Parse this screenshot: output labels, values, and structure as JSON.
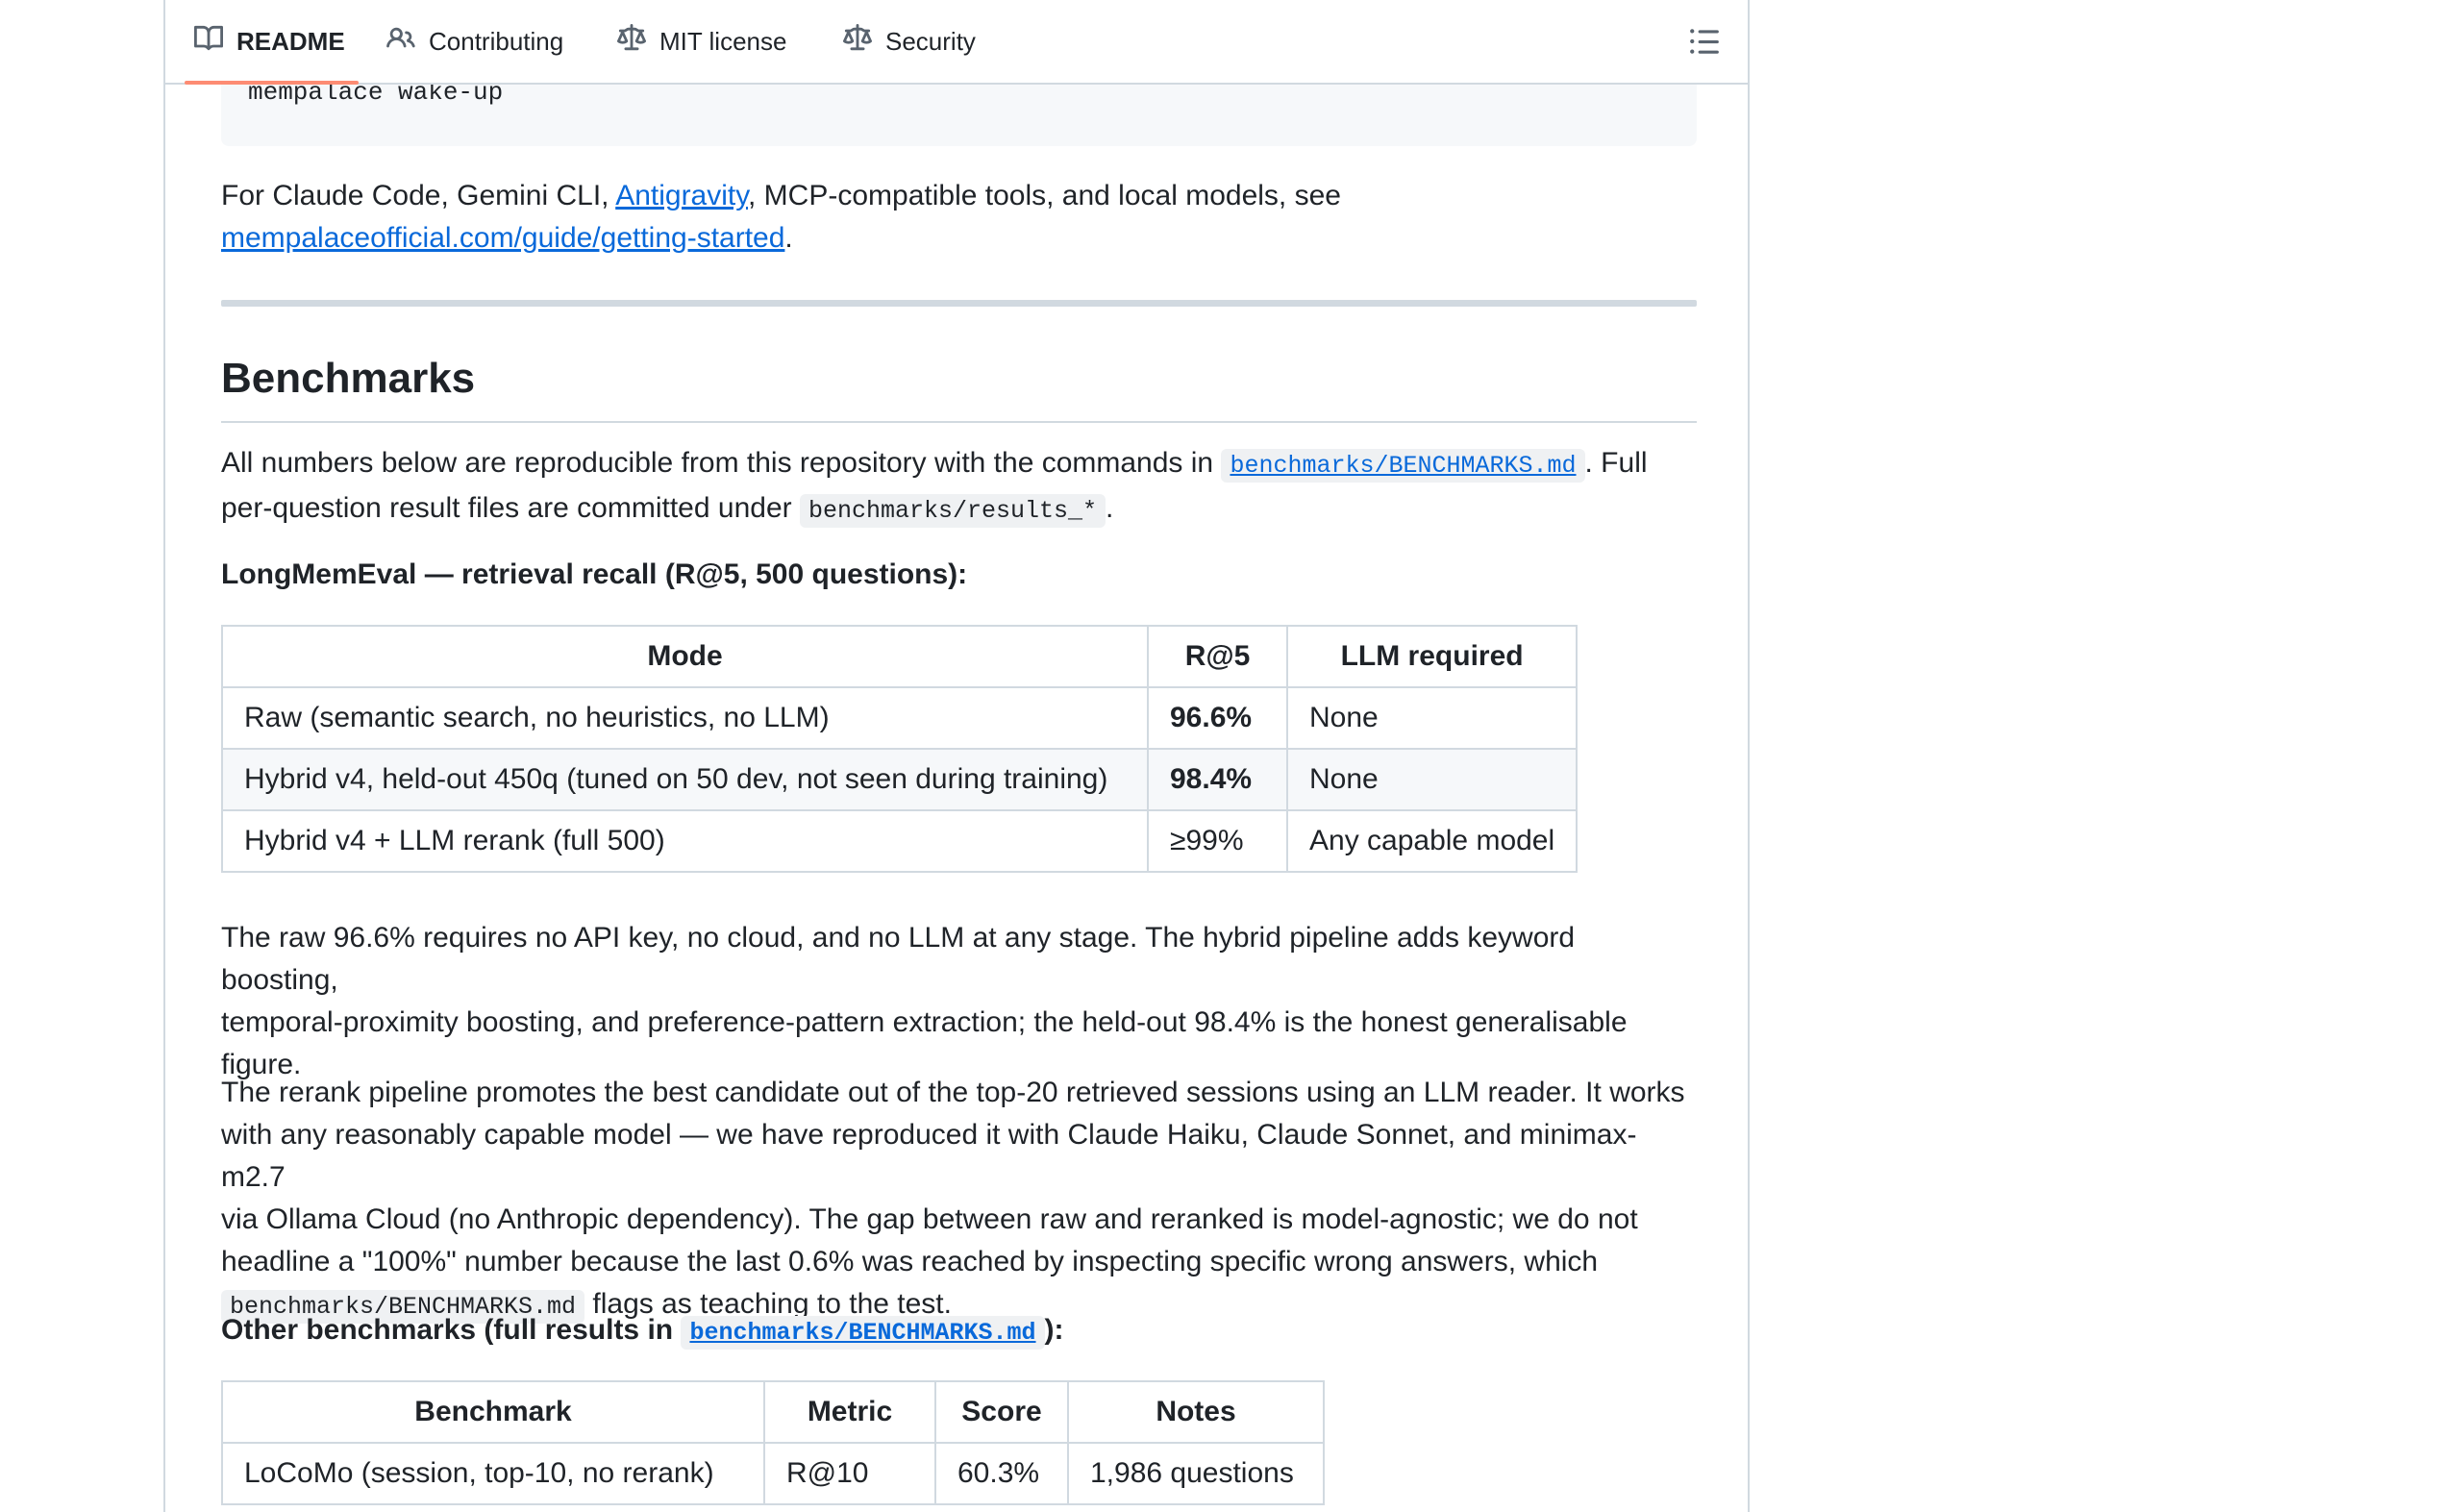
{
  "tabs": [
    {
      "label": "README",
      "icon": "book-icon",
      "active": true
    },
    {
      "label": "Contributing",
      "icon": "people-icon",
      "active": false
    },
    {
      "label": "MIT license",
      "icon": "law-icon",
      "active": false
    },
    {
      "label": "Security",
      "icon": "law-icon",
      "active": false
    }
  ],
  "toc_icon": "list-icon",
  "code_line": "mempalace wake-up",
  "intro": {
    "before": "For Claude Code, Gemini CLI, ",
    "link1": "Antigravity",
    "middle": ", MCP-compatible tools, and local models, see",
    "link2": "mempalaceofficial.com/guide/getting-started",
    "after": "."
  },
  "benchmarks": {
    "heading": "Benchmarks",
    "para1_a": "All numbers below are reproducible from this repository with the commands in ",
    "para1_code": "benchmarks/BENCHMARKS.md",
    "para1_b": ". Full",
    "para1_c": "per-question result files are committed under ",
    "para1_code2": "benchmarks/results_*",
    "para1_d": ".",
    "lme_title": "LongMemEval — retrieval recall (R@5, 500 questions):",
    "lme_table": {
      "headers": [
        "Mode",
        "R@5",
        "LLM required"
      ],
      "rows": [
        [
          "Raw (semantic search, no heuristics, no LLM)",
          "96.6%",
          "None"
        ],
        [
          "Hybrid v4, held-out 450q (tuned on 50 dev, not seen during training)",
          "98.4%",
          "None"
        ],
        [
          "Hybrid v4 + LLM rerank (full 500)",
          "≥99%",
          "Any capable model"
        ]
      ]
    },
    "para2": [
      "The raw 96.6% requires no API key, no cloud, and no LLM at any stage. The hybrid pipeline adds keyword boosting,",
      "temporal-proximity boosting, and preference-pattern extraction; the held-out 98.4% is the honest generalisable",
      "figure."
    ],
    "para3": [
      "The rerank pipeline promotes the best candidate out of the top-20 retrieved sessions using an LLM reader. It works",
      "with any reasonably capable model — we have reproduced it with Claude Haiku, Claude Sonnet, and minimax-m2.7",
      "via Ollama Cloud (no Anthropic dependency). The gap between raw and reranked is model-agnostic; we do not",
      "headline a \"100%\" number because the last 0.6% was reached by inspecting specific wrong answers, which"
    ],
    "para3_code": "benchmarks/BENCHMARKS.md",
    "para3_end": " flags as teaching to the test.",
    "other_title_a": "Other benchmarks (full results in ",
    "other_title_code": "benchmarks/BENCHMARKS.md",
    "other_title_b": "):",
    "other_table": {
      "headers": [
        "Benchmark",
        "Metric",
        "Score",
        "Notes"
      ],
      "rows": [
        [
          "LoCoMo (session, top-10, no rerank)",
          "R@10",
          "60.3%",
          "1,986 questions"
        ]
      ]
    }
  }
}
